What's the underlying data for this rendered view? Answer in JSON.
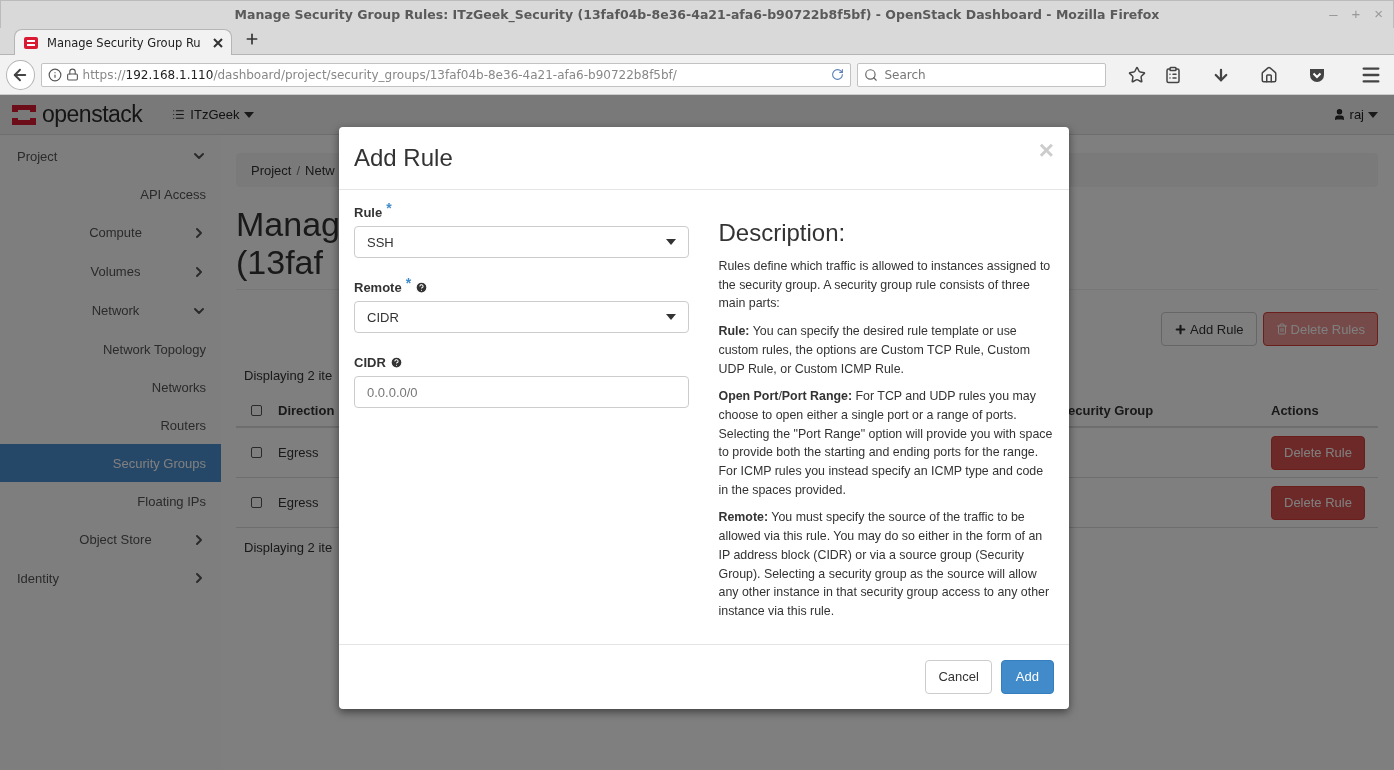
{
  "window": {
    "title": "Manage Security Group Rules: ITzGeek_Security (13faf04b-8e36-4a21-afa6-b90722b8f5bf) - OpenStack Dashboard - Mozilla Firefox",
    "controls": [
      "–",
      "+",
      "×"
    ]
  },
  "browser": {
    "tabs": [
      {
        "label": "Manage Security Group Ru",
        "selected": true
      }
    ],
    "url": {
      "scheme": "https://",
      "host": "192.168.1.110",
      "path": "/dashboard/project/security_groups/13faf04b-8e36-4a21-afa6-b90722b8f5bf/"
    },
    "search": {
      "placeholder": "Search"
    }
  },
  "header": {
    "logo": "openstack",
    "project": "ITzGeek",
    "user": "raj"
  },
  "sidebar": {
    "items": [
      {
        "label": "Project",
        "expanded": true,
        "children": [
          {
            "label": "API Access",
            "selected": false
          },
          {
            "label": "Compute",
            "expanded": false
          },
          {
            "label": "Volumes",
            "expanded": false
          },
          {
            "label": "Network",
            "expanded": true,
            "children": [
              {
                "label": "Network Topology",
                "selected": false
              },
              {
                "label": "Networks",
                "selected": false
              },
              {
                "label": "Routers",
                "selected": false
              },
              {
                "label": "Security Groups",
                "selected": true
              },
              {
                "label": "Floating IPs",
                "selected": false
              }
            ]
          },
          {
            "label": "Object Store",
            "expanded": false
          }
        ]
      },
      {
        "label": "Identity",
        "expanded": false
      }
    ]
  },
  "page": {
    "breadcrumb": {
      "items": [
        "Project",
        "Netw"
      ],
      "separator": "/"
    },
    "title_lines": [
      "Manag",
      "(13faf"
    ],
    "toolbar": [
      "Add Rule",
      "Delete Rules"
    ],
    "table": {
      "count_top": "Displaying 2 ite",
      "count_bottom": "Displaying 2 ite",
      "select_all": {
        "checked": false
      },
      "columns": [
        "Direction",
        "ecurity Group",
        "Actions"
      ],
      "rows": [
        {
          "checked": false,
          "direction": "Egress",
          "action": "Delete Rule"
        },
        {
          "checked": false,
          "direction": "Egress",
          "action": "Delete Rule"
        }
      ]
    }
  },
  "modal": {
    "title": "Add Rule",
    "close": "×",
    "required_mark": "*",
    "fields": [
      {
        "label": "Rule",
        "required": true,
        "help": false,
        "kind": "select",
        "value": "SSH"
      },
      {
        "label": "Remote",
        "required": true,
        "help": true,
        "kind": "select",
        "value": "CIDR"
      },
      {
        "label": "CIDR",
        "required": false,
        "help": true,
        "kind": "input",
        "placeholder": "0.0.0.0/0"
      }
    ],
    "description_title": "Description:",
    "description": [
      "Rules define which traffic is allowed to instances assigned to the security group. A security group rule consists of three main parts:",
      "**Rule:** You can specify the desired rule template or use custom rules, the options are Custom TCP Rule, Custom UDP Rule, or Custom ICMP Rule.",
      "**Open Port**/**Port Range:** For TCP and UDP rules you may choose to open either a single port or a range of ports. Selecting the \"Port Range\" option will provide you with space to provide both the starting and ending ports for the range. For ICMP rules you instead specify an ICMP type and code in the spaces provided.",
      "**Remote:** You must specify the source of the traffic to be allowed via this rule. You may do so either in the form of an IP address block (CIDR) or via a source group (Security Group). Selecting a security group as the source will allow any other instance in that security group access to any other instance via this rule."
    ],
    "buttons": [
      "Cancel",
      "Add"
    ]
  }
}
